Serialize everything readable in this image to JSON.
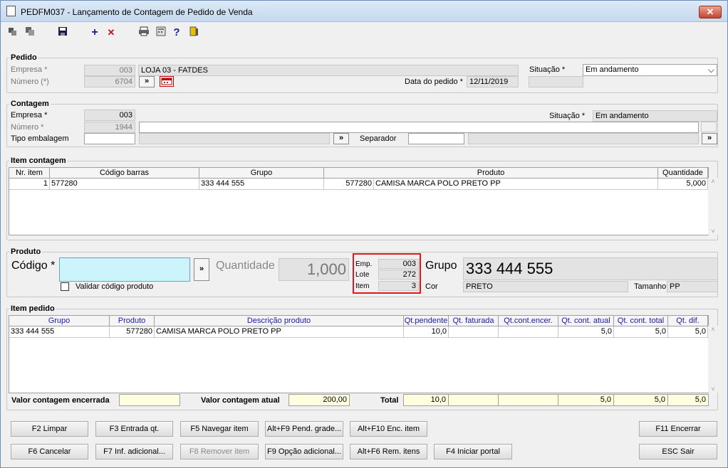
{
  "window": {
    "title": "PEDFM037 - Lançamento de Contagem de Pedido de Venda",
    "close": "✕"
  },
  "toolbar": {
    "plus": "+",
    "delete": "✕",
    "help": "?"
  },
  "pedido": {
    "legend": "Pedido",
    "empresa_label": "Empresa *",
    "empresa_code": "003",
    "empresa_name": "LOJA 03 - FATDES",
    "numero_label": "Número (*)",
    "numero": "6704",
    "nav": "»",
    "data_label": "Data do pedido *",
    "data": "12/11/2019",
    "situacao_label": "Situação *",
    "situacao": "Em andamento",
    "dropdown": "⌵"
  },
  "contagem": {
    "legend": "Contagem",
    "empresa_label": "Empresa *",
    "empresa": "003",
    "numero_label": "Número *",
    "numero": "1944",
    "tipo_label": "Tipo embalagem",
    "nav": "»",
    "separador_label": "Separador",
    "situacao_label": "Situação *",
    "situacao": "Em andamento"
  },
  "item_contagem": {
    "legend": "Item contagem",
    "headers": [
      "Nr. item",
      "Código barras",
      "Grupo",
      "Produto",
      "Quantidade"
    ],
    "row": {
      "nr": "1",
      "codigo": "577280",
      "grupo": "333 444 555",
      "produto_cod": "577280",
      "produto": "CAMISA MARCA POLO PRETO PP",
      "qtd": "5,000"
    }
  },
  "produto": {
    "legend": "Produto",
    "codigo_label": "Código *",
    "nav": "»",
    "quantidade_label": "Quantidade",
    "quantidade": "1,000",
    "validar_label": "Validar código produto",
    "emp_label": "Emp.",
    "emp": "003",
    "lote_label": "Lote",
    "lote": "272",
    "item_label": "Item",
    "item": "3",
    "grupo_label": "Grupo",
    "grupo": "333 444 555",
    "cor_label": "Cor",
    "cor": "PRETO",
    "tamanho_label": "Tamanho",
    "tamanho": "PP"
  },
  "item_pedido": {
    "legend": "Item pedido",
    "headers": [
      "Grupo",
      "Produto",
      "Descrição produto",
      "Qt.pendente",
      "Qt. faturada",
      "Qt.cont.encer.",
      "Qt. cont. atual",
      "Qt. cont. total",
      "Qt. dif."
    ],
    "row": {
      "grupo": "333 444 555",
      "produto": "577280",
      "descricao": "CAMISA MARCA POLO PRETO PP",
      "pendente": "10,0",
      "faturada": "",
      "encer": "",
      "atual": "5,0",
      "total": "5,0",
      "dif": "5,0"
    },
    "valor_encerrada_label": "Valor contagem encerrada",
    "valor_encerrada": "",
    "valor_atual_label": "Valor contagem atual",
    "valor_atual": "200,00",
    "total_label": "Total",
    "totals": {
      "pendente": "10,0",
      "faturada": "",
      "encer": "",
      "atual": "5,0",
      "total": "5,0",
      "dif": "5,0"
    }
  },
  "buttons": {
    "f2": "F2 Limpar",
    "f3": "F3 Entrada qt.",
    "f5": "F5 Navegar item",
    "altf9": "Alt+F9 Pend. grade...",
    "altf10": "Alt+F10 Enc. item",
    "f11": "F11 Encerrar",
    "f6": "F6 Cancelar",
    "f7": "F7 Inf. adicional...",
    "f8": "F8 Remover item",
    "f9": "F9 Opção adicional...",
    "altf6": "Alt+F6 Rem. itens",
    "f4": "F4 Iniciar portal",
    "esc": "ESC Sair"
  }
}
